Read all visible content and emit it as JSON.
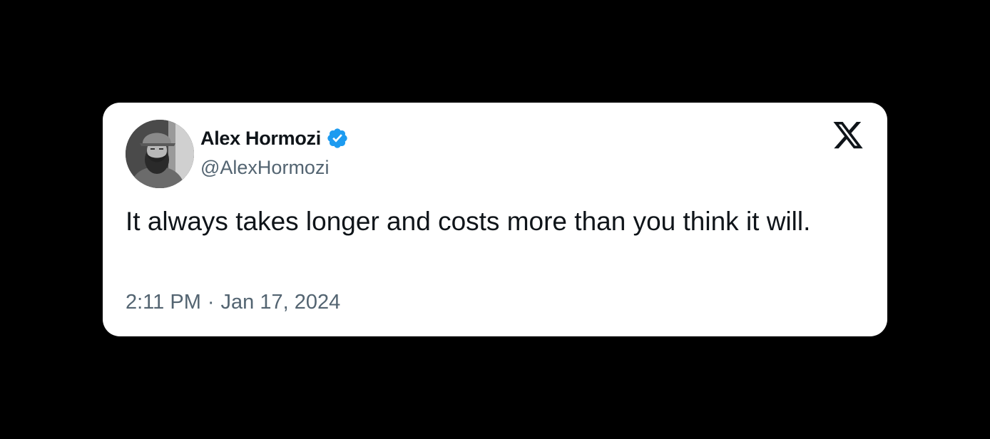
{
  "tweet": {
    "author_name": "Alex Hormozi",
    "author_handle": "@AlexHormozi",
    "verified": true,
    "text": "It always takes longer and costs more than you think it will.",
    "time": "2:11 PM",
    "separator": "·",
    "date": "Jan 17, 2024"
  },
  "icons": {
    "verified": "verified-badge-icon",
    "platform": "x-logo-icon"
  },
  "colors": {
    "background": "#000000",
    "card": "#ffffff",
    "text_primary": "#0f1419",
    "text_secondary": "#536471",
    "verified_blue": "#1d9bf0"
  }
}
